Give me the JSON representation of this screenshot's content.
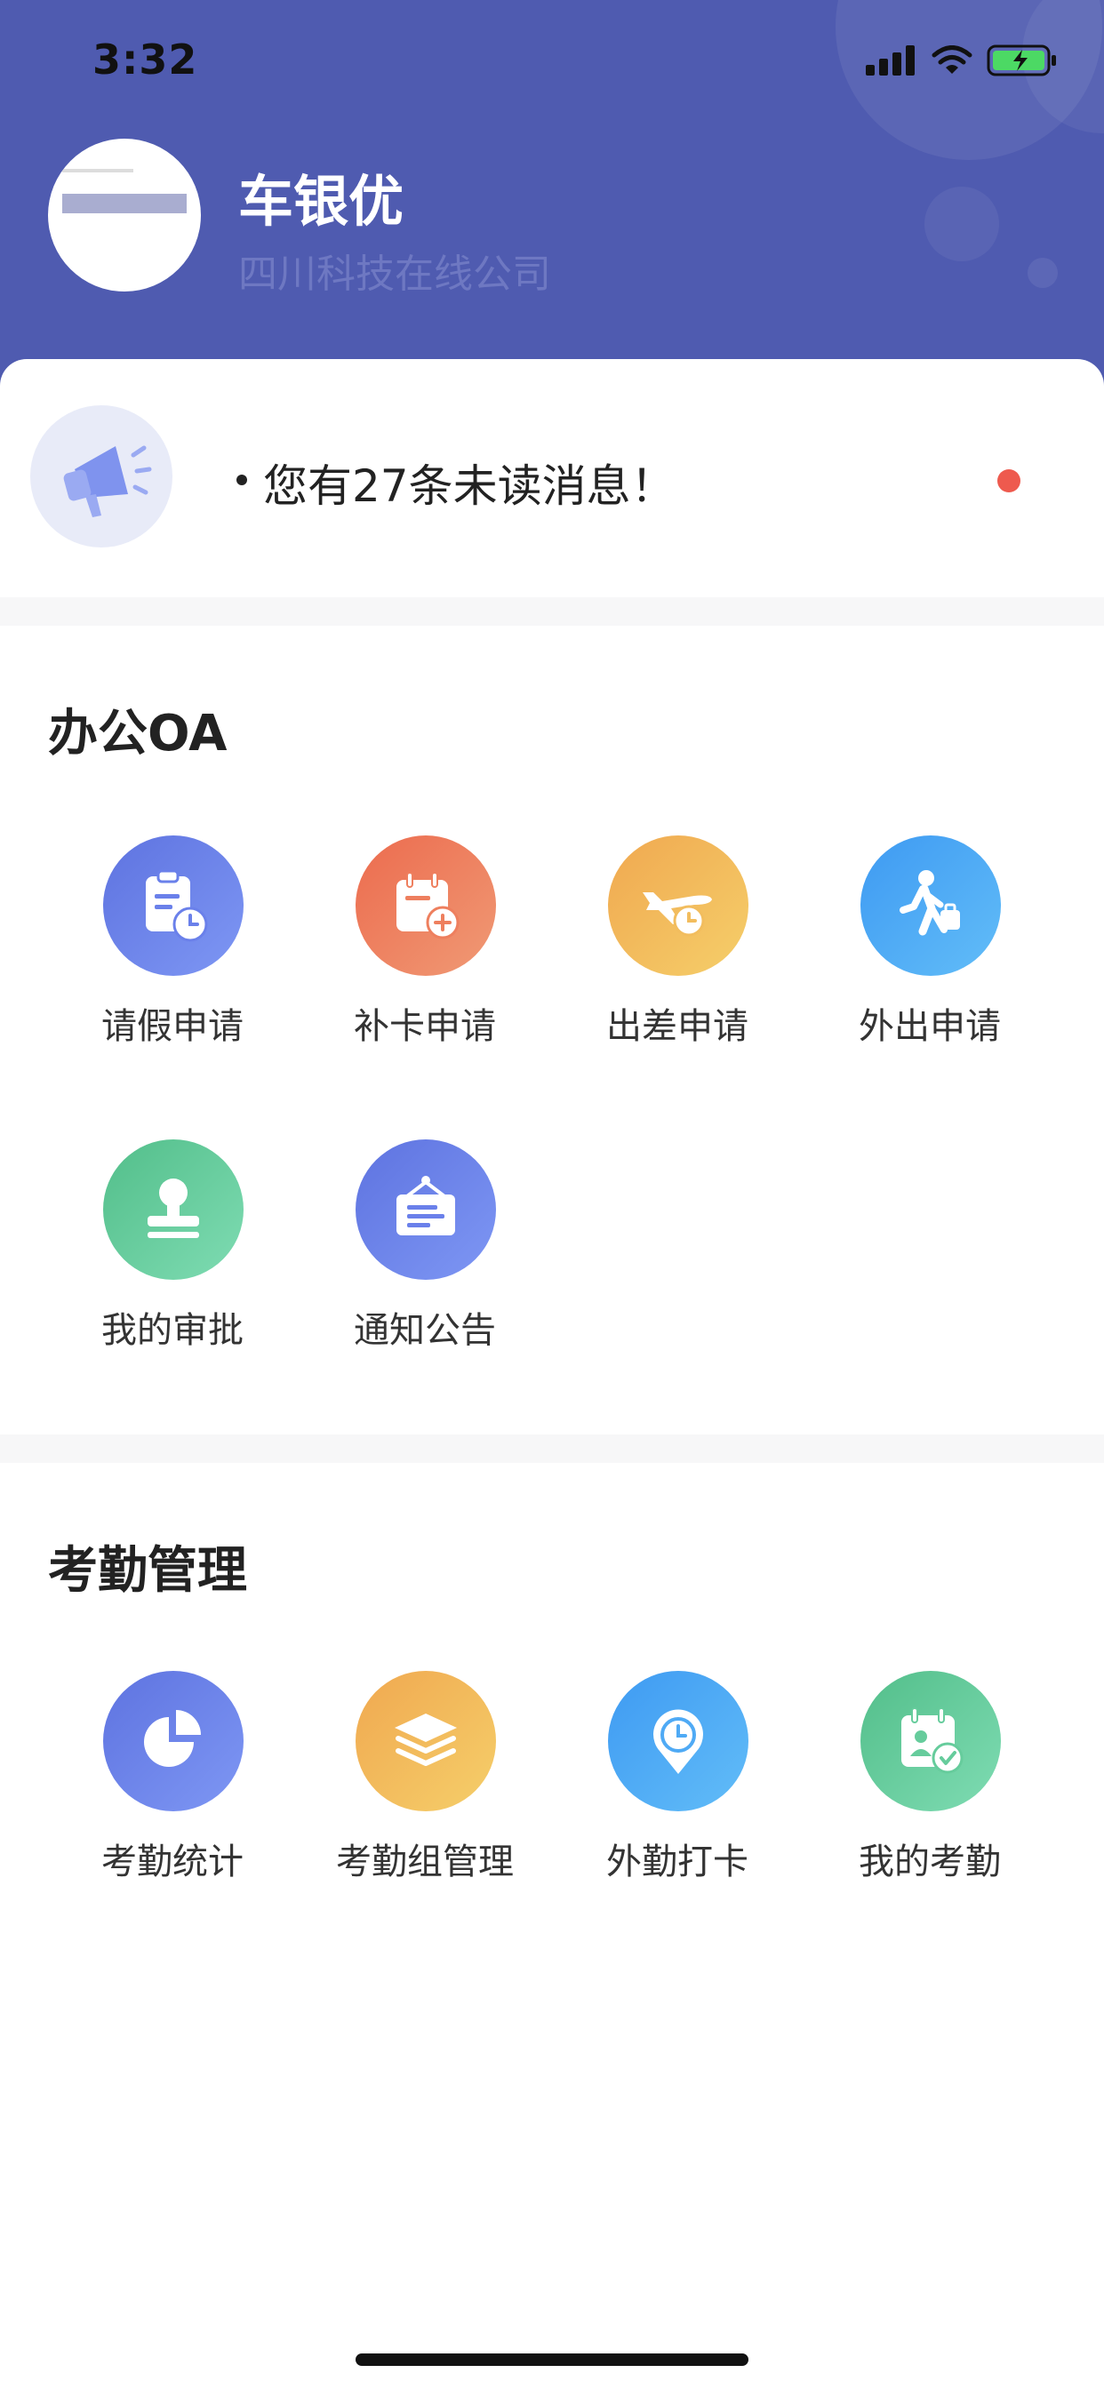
{
  "status_bar": {
    "time": "3:32"
  },
  "profile": {
    "name": "车银优",
    "company": "四川科技在线公司"
  },
  "notice": {
    "text": "您有27条未读消息！"
  },
  "sections": [
    {
      "title": "办公OA",
      "items": [
        {
          "label": "请假申请",
          "icon": "clipboard-clock-icon",
          "color": "#6A80EA"
        },
        {
          "label": "补卡申请",
          "icon": "calendar-plus-icon",
          "color": "#EE7F5E"
        },
        {
          "label": "出差申请",
          "icon": "airplane-clock-icon",
          "color": "#F2BD5E"
        },
        {
          "label": "外出申请",
          "icon": "walking-person-icon",
          "color": "#4FAAF5"
        },
        {
          "label": "我的审批",
          "icon": "stamp-icon",
          "color": "#66CC9C"
        },
        {
          "label": "通知公告",
          "icon": "notice-board-icon",
          "color": "#6A80EA"
        }
      ]
    },
    {
      "title": "考勤管理",
      "items": [
        {
          "label": "考勤统计",
          "icon": "pie-chart-icon",
          "color": "#6A80EA"
        },
        {
          "label": "考勤组管理",
          "icon": "layers-icon",
          "color": "#F2BD5E"
        },
        {
          "label": "外勤打卡",
          "icon": "location-clock-icon",
          "color": "#4FAAF5"
        },
        {
          "label": "我的考勤",
          "icon": "calendar-check-icon",
          "color": "#66CC9C"
        }
      ]
    }
  ],
  "colors": {
    "header": "#4F5BB0",
    "unread_dot": "#EE5A4E"
  }
}
